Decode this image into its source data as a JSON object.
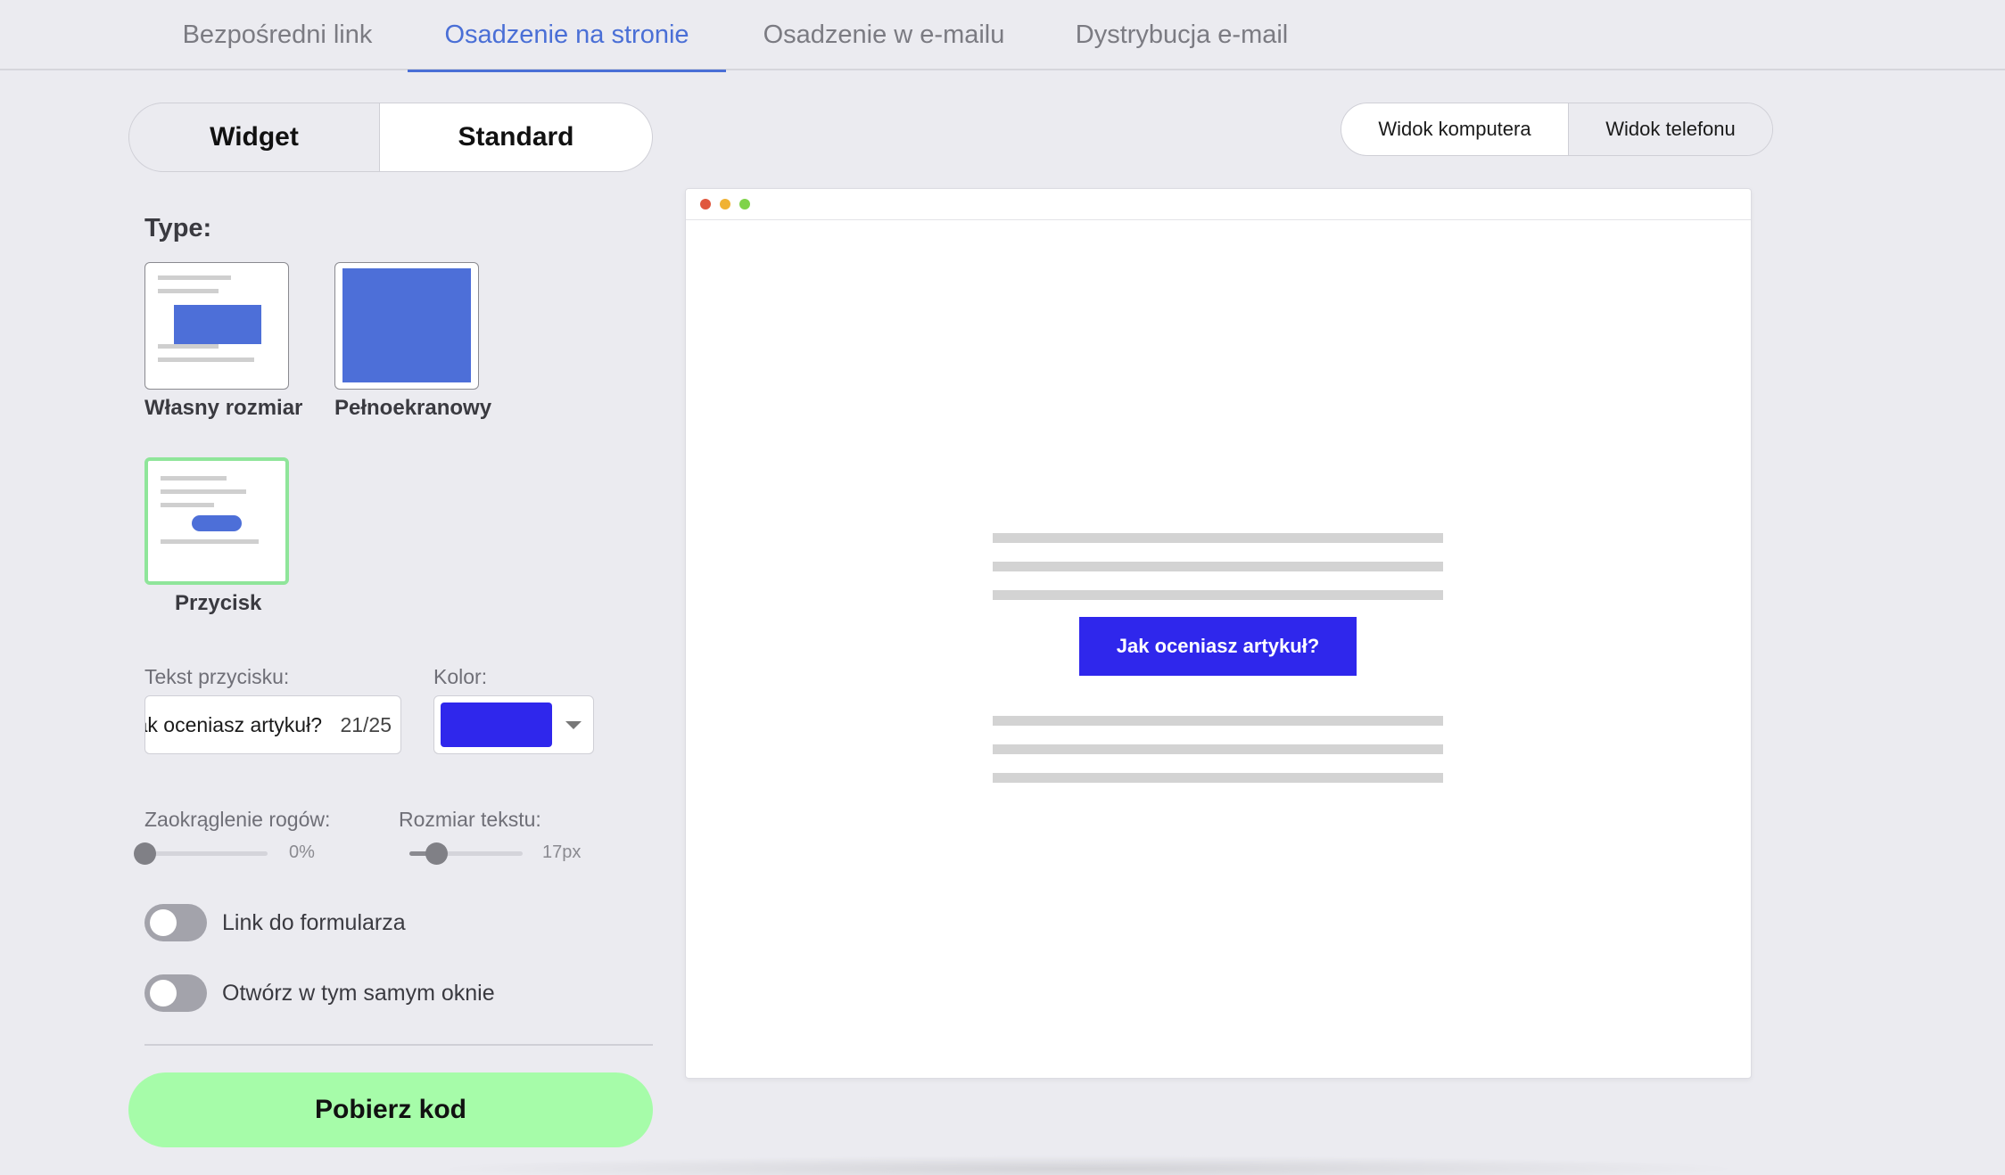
{
  "tabs": [
    {
      "label": "Bezpośredni link",
      "active": false
    },
    {
      "label": "Osadzenie na stronie",
      "active": true
    },
    {
      "label": "Osadzenie w e-mailu",
      "active": false
    },
    {
      "label": "Dystrybucja e-mail",
      "active": false
    }
  ],
  "mode_switch": {
    "widget": "Widget",
    "standard": "Standard",
    "selected": "Standard"
  },
  "view_switch": {
    "desktop": "Widok komputera",
    "phone": "Widok telefonu",
    "selected": "Widok komputera"
  },
  "type_section": {
    "label": "Type:",
    "options": [
      {
        "label": "Własny rozmiar",
        "selected": false
      },
      {
        "label": "Pełnoekranowy",
        "selected": false
      },
      {
        "label": "Przycisk",
        "selected": true
      }
    ]
  },
  "button_text": {
    "label": "Tekst przycisku:",
    "value": "Jak oceniasz artykuł?",
    "counter": "21/25"
  },
  "color": {
    "label": "Kolor:",
    "value": "#2f27ec"
  },
  "corner_radius": {
    "label": "Zaokrąglenie rogów:",
    "value_text": "0%",
    "value": 0
  },
  "text_size": {
    "label": "Rozmiar tekstu:",
    "value_text": "17px",
    "fraction": 0.24
  },
  "toggles": [
    {
      "label": "Link do formularza",
      "on": false
    },
    {
      "label": "Otwórz w tym samym oknie",
      "on": false
    }
  ],
  "cta": {
    "label": "Pobierz kod",
    "color": "#a6fca9"
  },
  "preview": {
    "button_label": "Jak oceniasz artykuł?",
    "button_color": "#2f27ec",
    "dots": [
      "#e0573e",
      "#f0b233",
      "#7fd34a"
    ]
  },
  "accent": "#4a6fd6"
}
